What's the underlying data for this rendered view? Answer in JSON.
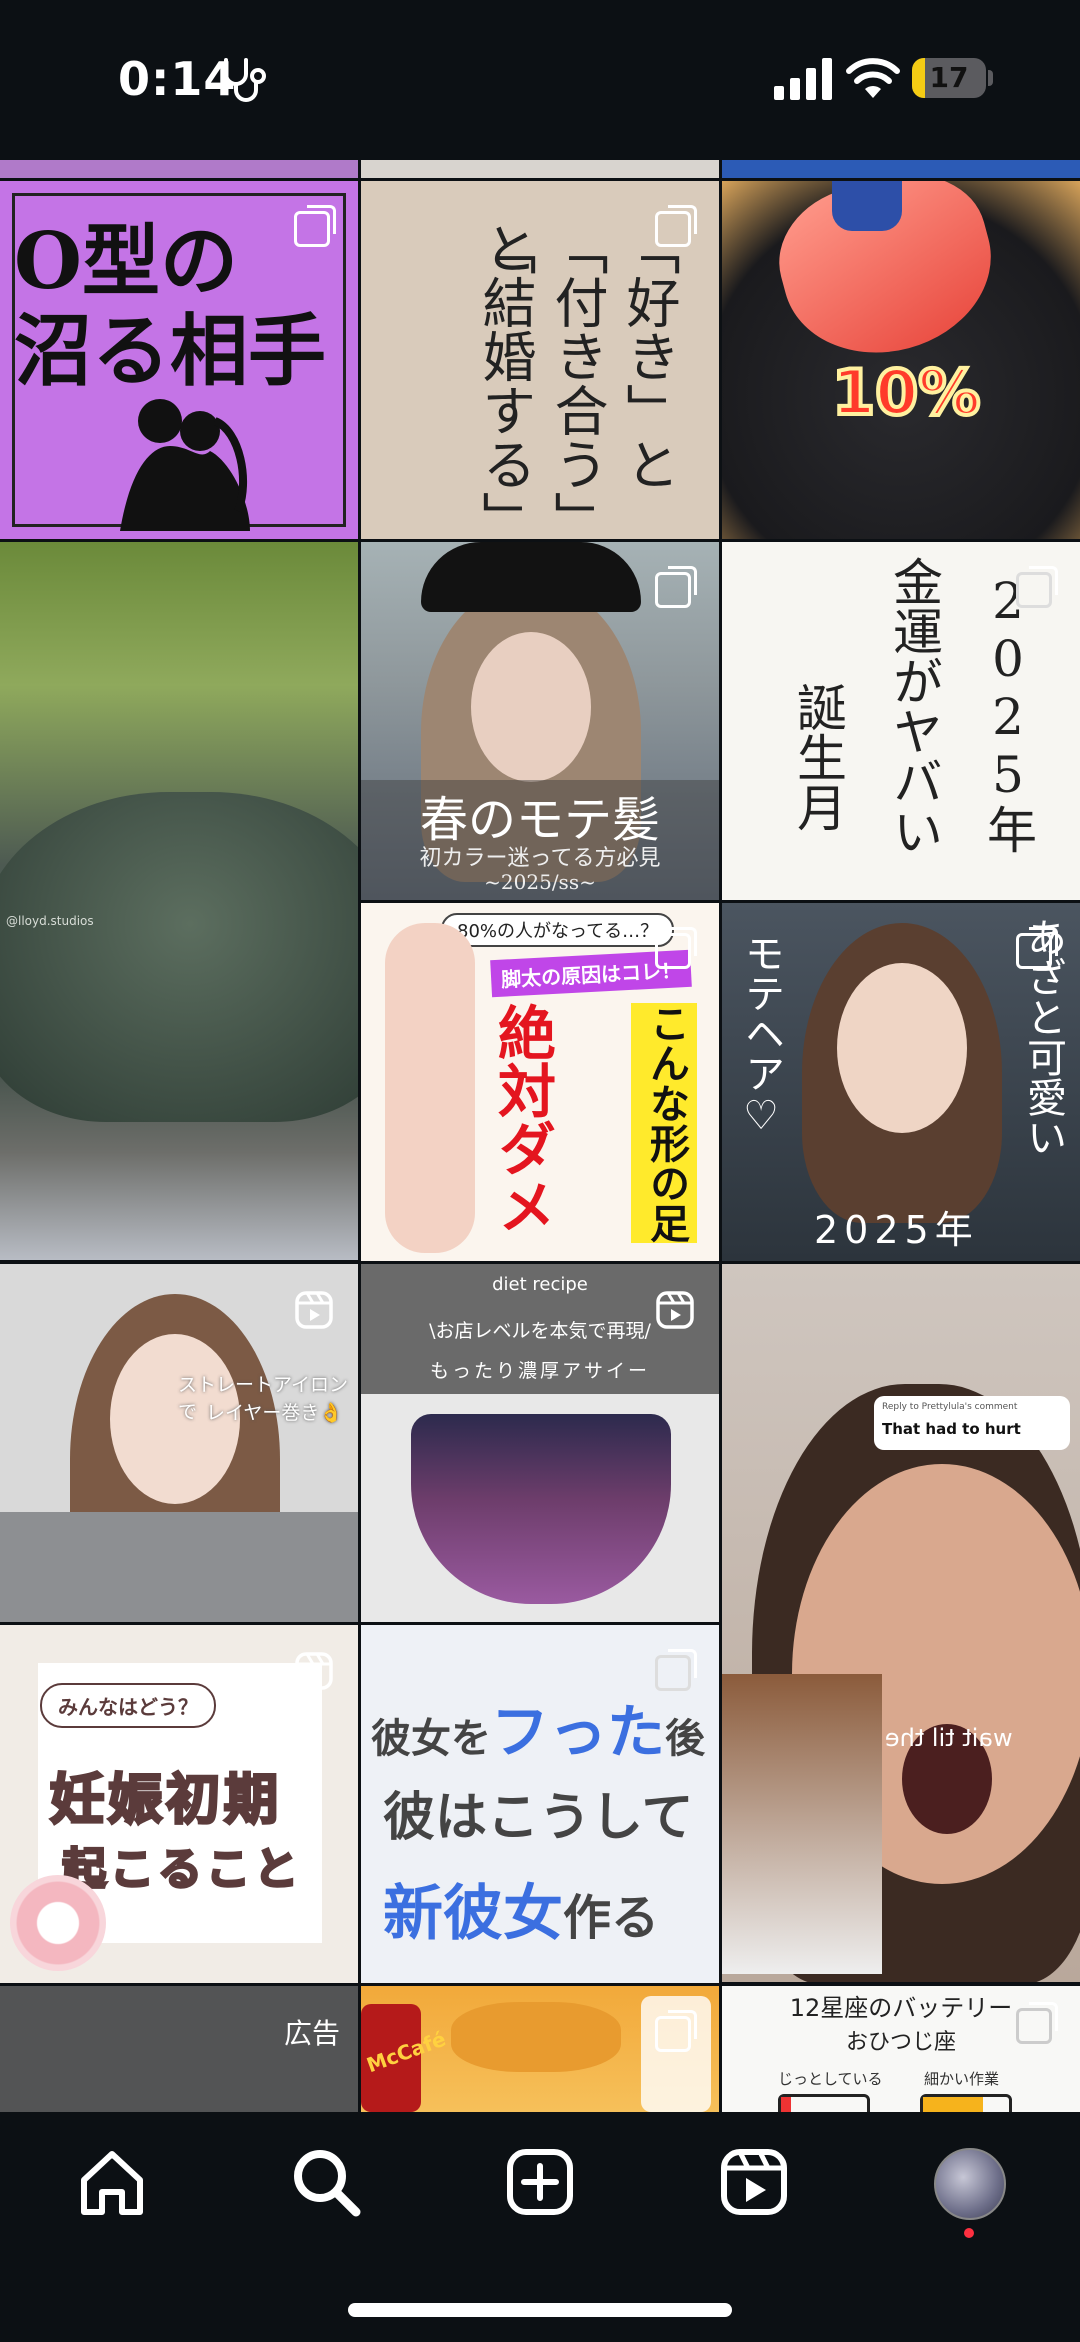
{
  "status_bar": {
    "time": "0:14",
    "battery": "17",
    "battery_level": 0.17,
    "battery_color": "#f5cc14"
  },
  "grid": {
    "tiles": [
      {
        "id": "o-type",
        "title_line1": "O型の",
        "title_line2": "沼る相手",
        "badge": "multi-icon"
      },
      {
        "id": "love-phrases",
        "col1": "「好き」と",
        "col2": "「付き合う」と",
        "col3": "「結婚する」",
        "badge": "multi-icon"
      },
      {
        "id": "sashimi",
        "caption": "10%",
        "badge": "none"
      },
      {
        "id": "crocodile",
        "watermark": "@lloyd.studios",
        "badge": "none"
      },
      {
        "id": "spring-hair",
        "title": "春のモテ髪",
        "subtitle": "初カラー迷ってる方必見",
        "date": "~2025/ss~",
        "badge": "multi-icon"
      },
      {
        "id": "money-luck",
        "col_a": "2025年",
        "col_b": "金運がヤバい",
        "col_c": "誕生月",
        "badge": "multi-icon"
      },
      {
        "id": "legs",
        "top": "80%の人がなってる…？",
        "tag": "脚太の原因はコレ！",
        "big": "絶対ダメ",
        "side": "こんな形の足",
        "badge": "multi-icon"
      },
      {
        "id": "mote-hair",
        "left": "モテヘア♡",
        "right": "あざと可愛い",
        "bottom": "2025年",
        "badge": "multi-icon"
      },
      {
        "id": "straight-iron",
        "caption_line1": "ストレートアイロンで",
        "caption_line2": "レイヤー巻き👌",
        "badge": "reel-icon"
      },
      {
        "id": "acai",
        "top": "diet recipe",
        "line1": "\\お店レベルを本気で再現/",
        "line2": "もったり濃厚アサイー",
        "badge": "reel-icon"
      },
      {
        "id": "reaction",
        "reply_header": "Reply to Prettylula's comment",
        "reply_text": "That had to hurt",
        "overlay": "wait til the end",
        "badge": "none"
      },
      {
        "id": "pregnancy",
        "bubble": "みんなはどう？",
        "line1": "妊娠初期",
        "line2": "起こること",
        "badge": "reel-icon"
      },
      {
        "id": "breakup",
        "line1a": "彼女を",
        "line1b": "フった",
        "line1c": "後",
        "line2": "彼はこうして",
        "line3a": "新彼女",
        "line3b": "作る",
        "badge": "multi-icon"
      },
      {
        "id": "ad",
        "label": "広告",
        "badge": "none"
      },
      {
        "id": "mcd",
        "logo": "McCafé",
        "badge": "multi-icon"
      },
      {
        "id": "zodiac",
        "title": "12星座のバッテリー",
        "sign": "おひつじ座",
        "label1": "じっとしている",
        "label2": "細かい作業",
        "badge": "multi-icon"
      }
    ]
  },
  "nav": {
    "items": [
      "home-icon",
      "search-icon",
      "create-icon",
      "reels-icon",
      "profile-avatar"
    ],
    "notification_color": "#ff3040"
  }
}
